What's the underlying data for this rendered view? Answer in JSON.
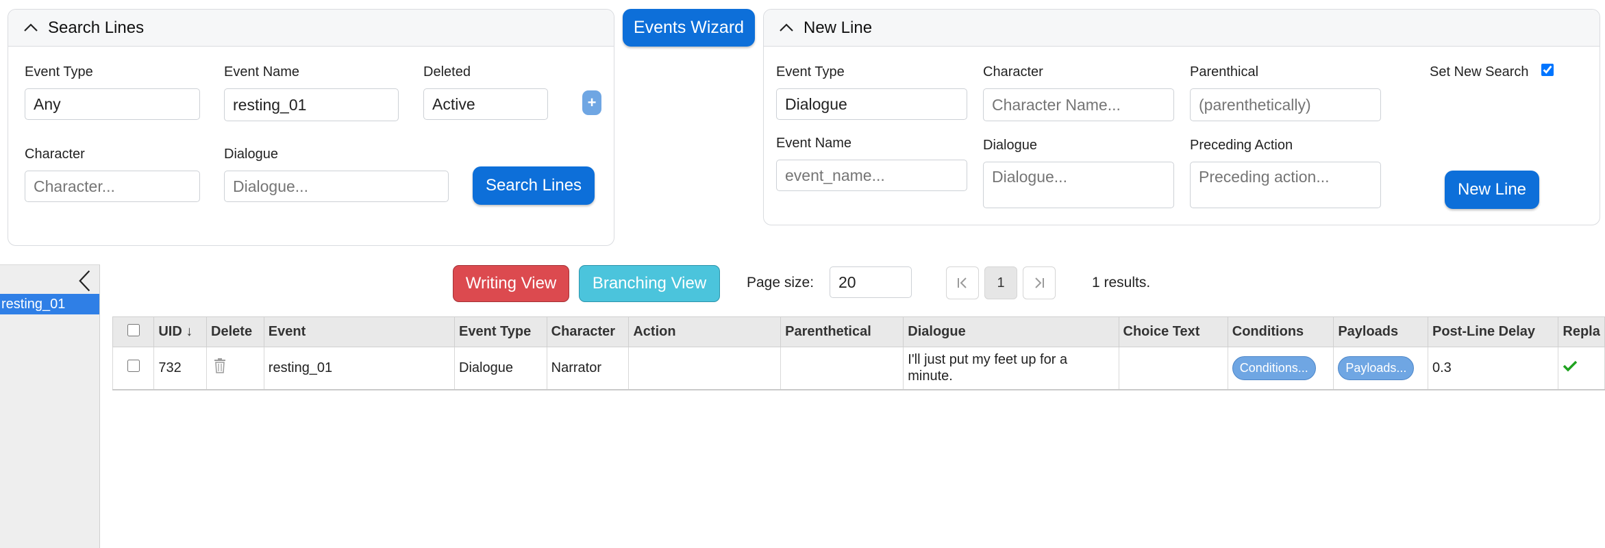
{
  "search_panel": {
    "title": "Search Lines",
    "event_type_label": "Event Type",
    "event_type_value": "Any",
    "event_name_label": "Event Name",
    "event_name_value": "resting_01",
    "deleted_label": "Deleted",
    "deleted_value": "Active",
    "plus_label": "+",
    "character_label": "Character",
    "character_placeholder": "Character...",
    "dialogue_label": "Dialogue",
    "dialogue_placeholder": "Dialogue...",
    "search_button": "Search Lines"
  },
  "events_wizard_button": "Events Wizard",
  "new_line_panel": {
    "title": "New Line",
    "event_type_label": "Event Type",
    "event_type_value": "Dialogue",
    "character_label": "Character",
    "character_placeholder": "Character Name...",
    "parenthetical_label": "Parenthical",
    "parenthetical_placeholder": "(parenthetically)",
    "set_new_search_label": "Set New Search",
    "set_new_search_checked": true,
    "event_name_label": "Event Name",
    "event_name_placeholder": "event_name...",
    "dialogue_label": "Dialogue",
    "dialogue_placeholder": "Dialogue...",
    "preceding_action_label": "Preceding Action",
    "preceding_action_placeholder": "Preceding action...",
    "new_line_button": "New Line"
  },
  "sidebar": {
    "items": [
      {
        "label": "resting_01",
        "selected": true
      }
    ]
  },
  "toolbar": {
    "writing_view": "Writing View",
    "branching_view": "Branching View",
    "page_size_label": "Page size:",
    "page_size_value": "20",
    "current_page": "1",
    "results_text": "1 results."
  },
  "table": {
    "headers": [
      "",
      "UID ↓",
      "Delete",
      "Event",
      "Event Type",
      "Character",
      "Action",
      "Parenthetical",
      "Dialogue",
      "Choice Text",
      "Conditions",
      "Payloads",
      "Post-Line Delay",
      "Repla"
    ],
    "rows": [
      {
        "uid": "732",
        "event": "resting_01",
        "event_type": "Dialogue",
        "character": "Narrator",
        "action": "",
        "parenthetical": "",
        "dialogue": "I'll just put my feet up for a minute.",
        "choice_text": "",
        "conditions": "Conditions...",
        "payloads": "Payloads...",
        "post_line_delay": "0.3"
      }
    ]
  },
  "colors": {
    "primary": "#0d6fd9",
    "writing_view": "#dc4a4f",
    "branching_view": "#4bc4dc",
    "pill": "#6fa6e3",
    "sidebar_selected": "#2f7fe6",
    "check_green": "#1fa21f"
  }
}
